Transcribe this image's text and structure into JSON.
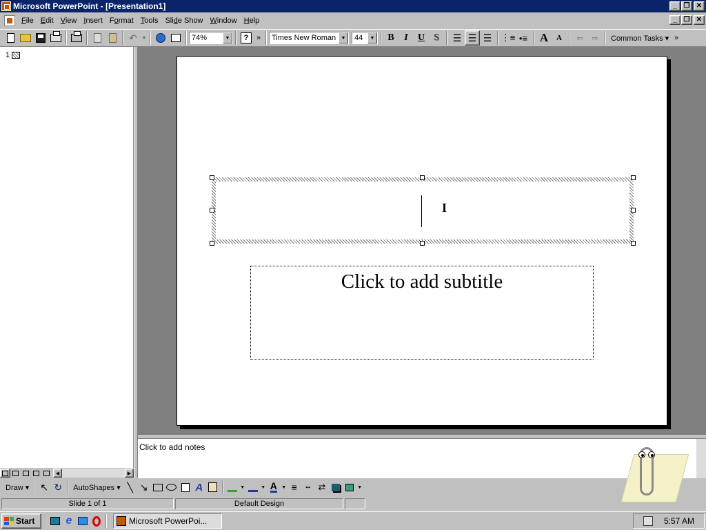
{
  "window": {
    "title": "Microsoft PowerPoint - [Presentation1]",
    "caption_buttons": [
      "_",
      "❐",
      "✕"
    ],
    "doc_buttons": [
      "_",
      "❐",
      "✕"
    ]
  },
  "menu": {
    "items": [
      "File",
      "Edit",
      "View",
      "Insert",
      "Format",
      "Tools",
      "Slide Show",
      "Window",
      "Help"
    ],
    "accelerators": [
      "F",
      "E",
      "V",
      "I",
      "o",
      "T",
      "d",
      "W",
      "H"
    ]
  },
  "toolbar": {
    "zoom": "74%",
    "font_name": "Times New Roman",
    "font_size": "44",
    "bold": "B",
    "italic": "I",
    "underline": "U",
    "shadow": "S",
    "grow_font": "A",
    "shrink_font": "A",
    "common_tasks": "Common Tasks ▾",
    "more": "»"
  },
  "outline": {
    "slide_number": "1"
  },
  "slide": {
    "title_placeholder": "",
    "ibeam": "I",
    "subtitle_placeholder": "Click to add subtitle"
  },
  "notes": {
    "placeholder": "Click to add notes"
  },
  "drawing": {
    "draw_label": "Draw ▾",
    "autoshapes_label": "AutoShapes ▾"
  },
  "status": {
    "slide": "Slide 1 of 1",
    "design": "Default Design",
    "extra": ""
  },
  "taskbar": {
    "start": "Start",
    "app": "Microsoft PowerPoi...",
    "time": "5:57 AM"
  },
  "colors": {
    "title_bar": "#0a246a",
    "face": "#c0c0c0",
    "slide_bg": "#808080",
    "powerpoint_orange": "#c65a00"
  }
}
